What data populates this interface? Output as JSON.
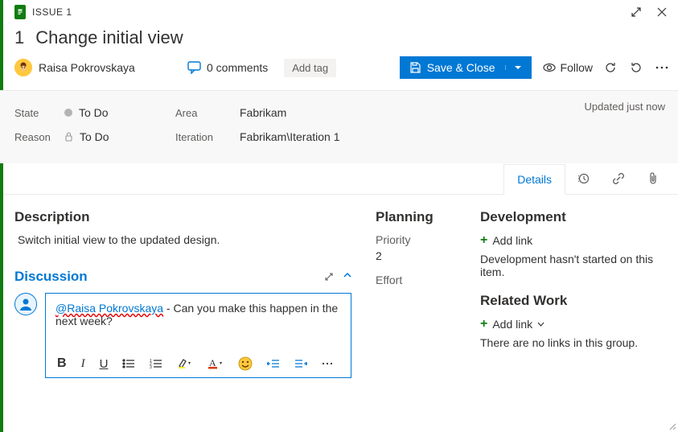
{
  "header": {
    "type_label": "ISSUE 1",
    "id": "1",
    "title": "Change initial view",
    "assignee": "Raisa Pokrovskaya",
    "comments_label": "0 comments",
    "add_tag_label": "Add tag",
    "save_label": "Save & Close",
    "follow_label": "Follow"
  },
  "meta": {
    "state_label": "State",
    "state_value": "To Do",
    "reason_label": "Reason",
    "reason_value": "To Do",
    "area_label": "Area",
    "area_value": "Fabrikam",
    "iteration_label": "Iteration",
    "iteration_value": "Fabrikam\\Iteration 1",
    "updated": "Updated just now"
  },
  "tabs": {
    "details": "Details"
  },
  "description": {
    "heading": "Description",
    "body": "Switch initial view to the updated design."
  },
  "discussion": {
    "heading": "Discussion",
    "mention": "@Raisa Pokrovskaya",
    "text": " - Can you make this happen in the next week?"
  },
  "planning": {
    "heading": "Planning",
    "priority_label": "Priority",
    "priority_value": "2",
    "effort_label": "Effort"
  },
  "development": {
    "heading": "Development",
    "add_link": "Add link",
    "help": "Development hasn't started on this item."
  },
  "related": {
    "heading": "Related Work",
    "add_link": "Add link",
    "help": "There are no links in this group."
  }
}
